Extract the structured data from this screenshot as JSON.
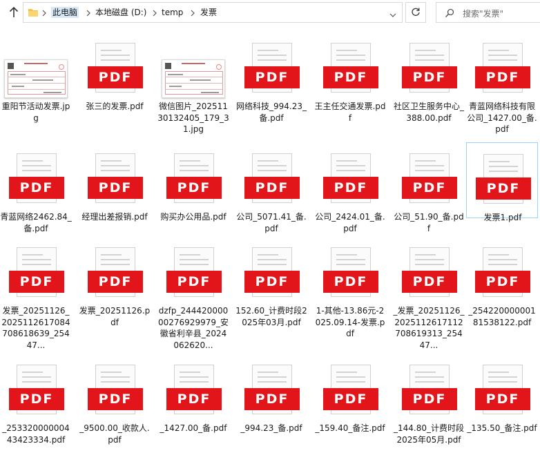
{
  "address": {
    "crumbs": [
      "此电脑",
      "本地磁盘 (D:)",
      "temp",
      "发票"
    ]
  },
  "search": {
    "placeholder": "搜索\"发票\""
  },
  "files": [
    {
      "name": "重阳节活动发票.jpg",
      "type": "image"
    },
    {
      "name": "张三的发票.pdf",
      "type": "pdf"
    },
    {
      "name": "微信图片_20251130132405_179_31.jpg",
      "type": "image"
    },
    {
      "name": "网络科技_994.23_备.pdf",
      "type": "pdf"
    },
    {
      "name": "王主任交通发票.pdf",
      "type": "pdf"
    },
    {
      "name": "社区卫生服务中心_388.00.pdf",
      "type": "pdf"
    },
    {
      "name": "青蓝网络科技有限公司_1427.00_备.pdf",
      "type": "pdf"
    },
    {
      "name": "青蓝网络2462.84_备.pdf",
      "type": "pdf"
    },
    {
      "name": "经理出差报销.pdf",
      "type": "pdf"
    },
    {
      "name": "购买办公用品.pdf",
      "type": "pdf"
    },
    {
      "name": "公司_5071.41_备.pdf",
      "type": "pdf"
    },
    {
      "name": "公司_2424.01_备.pdf",
      "type": "pdf"
    },
    {
      "name": "公司_51.90_备.pdf",
      "type": "pdf"
    },
    {
      "name": "发票1.pdf",
      "type": "pdf",
      "selected": true
    },
    {
      "name": "发票_20251126_2025112617084708618639_25447...",
      "type": "pdf"
    },
    {
      "name": "发票_20251126.pdf",
      "type": "pdf"
    },
    {
      "name": "dzfp_24442000000276929979_安徽省利辛县_2024062620...",
      "type": "pdf"
    },
    {
      "name": "152.60_计费时段2025年03月.pdf",
      "type": "pdf"
    },
    {
      "name": "1-其他-13.86元-2025.09.14-发票.pdf",
      "type": "pdf"
    },
    {
      "name": "_发票_20251126_2025112617112708619313_25447...",
      "type": "pdf"
    },
    {
      "name": "_25422000000181538122.pdf",
      "type": "pdf"
    },
    {
      "name": "_25332000000443423334.pdf",
      "type": "pdf"
    },
    {
      "name": "_9500.00_收款人.pdf",
      "type": "pdf"
    },
    {
      "name": "_1427.00_备.pdf",
      "type": "pdf"
    },
    {
      "name": "_994.23_备.pdf",
      "type": "pdf"
    },
    {
      "name": "_159.40_备注.pdf",
      "type": "pdf"
    },
    {
      "name": "_144.80_计费时段2025年05月.pdf",
      "type": "pdf"
    },
    {
      "name": "_135.50_备注.pdf",
      "type": "pdf"
    }
  ],
  "pdf_label": "PDF",
  "colors": {
    "pdf_red": "#e2151a",
    "selection": "#99d1ff",
    "crumb_highlight": "#d7e8f7"
  }
}
